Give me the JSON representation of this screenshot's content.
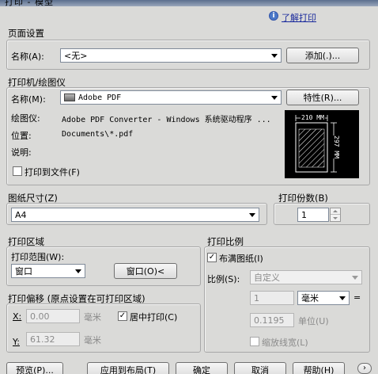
{
  "window": {
    "title": "打印 - 模型"
  },
  "help_link": "了解打印",
  "page_setup": {
    "title": "页面设置",
    "name_label": "名称(A):",
    "name_value": "<无>",
    "add_button": "添加(.)..."
  },
  "printer": {
    "title": "打印机/绘图仪",
    "name_label": "名称(M):",
    "name_value": "Adobe PDF",
    "properties_button": "特性(R)...",
    "plotter_label": "绘图仪:",
    "plotter_value": "Adobe PDF Converter - Windows 系统驱动程序 ...",
    "location_label": "位置:",
    "location_value": "Documents\\*.pdf",
    "description_label": "说明:",
    "print_to_file_label": "打印到文件(F)",
    "print_to_file_checked": false,
    "preview_width_label": "210 MM",
    "preview_height_label": "297 MM"
  },
  "paper_size": {
    "title": "图纸尺寸(Z)",
    "value": "A4"
  },
  "copies": {
    "title": "打印份数(B)",
    "value": "1"
  },
  "plot_area": {
    "title": "打印区域",
    "range_label": "打印范围(W):",
    "range_value": "窗口",
    "window_button": "窗口(O)<"
  },
  "plot_offset": {
    "title": "打印偏移 (原点设置在可打印区域)",
    "x_label": "X:",
    "x_value": "0.00",
    "x_unit": "毫米",
    "y_label": "Y:",
    "y_value": "61.32",
    "y_unit": "毫米",
    "center_label": "居中打印(C)",
    "center_checked": true
  },
  "plot_scale": {
    "title": "打印比例",
    "fit_label": "布满图纸(I)",
    "fit_checked": true,
    "scale_label": "比例(S):",
    "scale_value": "自定义",
    "value1": "1",
    "unit_value": "毫米",
    "equals": "=",
    "value2": "0.1195",
    "unit2_label": "单位(U)",
    "lineweight_label": "缩放线宽(L)",
    "lineweight_checked": false
  },
  "buttons": {
    "preview": "预览(P)...",
    "apply_layout": "应用到布局(T)",
    "ok": "确定",
    "cancel": "取消",
    "help": "帮助(H)"
  }
}
